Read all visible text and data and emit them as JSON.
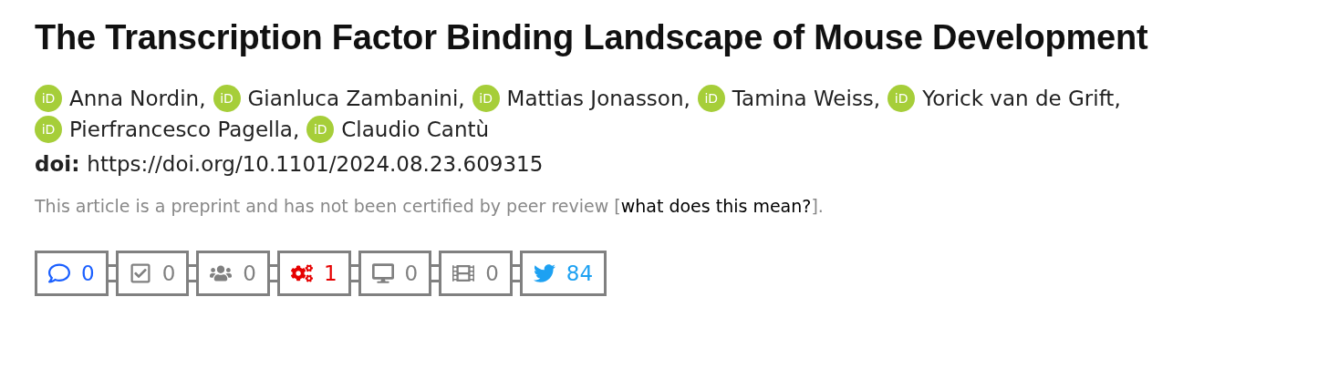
{
  "title": "The Transcription Factor Binding Landscape of Mouse Development",
  "authors": [
    {
      "orcid": "iD",
      "name": "Anna Nordin,"
    },
    {
      "orcid": "iD",
      "name": "Gianluca Zambanini,"
    },
    {
      "orcid": "iD",
      "name": "Mattias Jonasson,"
    },
    {
      "orcid": "iD",
      "name": "Tamina Weiss,"
    },
    {
      "orcid": "iD",
      "name": "Yorick van de Grift,"
    },
    {
      "orcid": "iD",
      "name": "Pierfrancesco Pagella,"
    },
    {
      "orcid": "iD",
      "name": "Claudio Cantù"
    }
  ],
  "doi": {
    "label": "doi:",
    "url": "https://doi.org/10.1101/2024.08.23.609315"
  },
  "notice": {
    "before": "This article is a preprint and has not been certified by peer review [",
    "link": "what does this mean?",
    "after": "]."
  },
  "metrics": [
    {
      "kind": "comments",
      "count": "0",
      "color": "#1a5fff"
    },
    {
      "kind": "reviews",
      "count": "0",
      "color": "#808080"
    },
    {
      "kind": "community",
      "count": "0",
      "color": "#808080"
    },
    {
      "kind": "code",
      "count": "1",
      "color": "#e60000"
    },
    {
      "kind": "media",
      "count": "0",
      "color": "#808080"
    },
    {
      "kind": "video",
      "count": "0",
      "color": "#808080"
    },
    {
      "kind": "twitter",
      "count": "84",
      "color": "#1da1f2"
    }
  ]
}
